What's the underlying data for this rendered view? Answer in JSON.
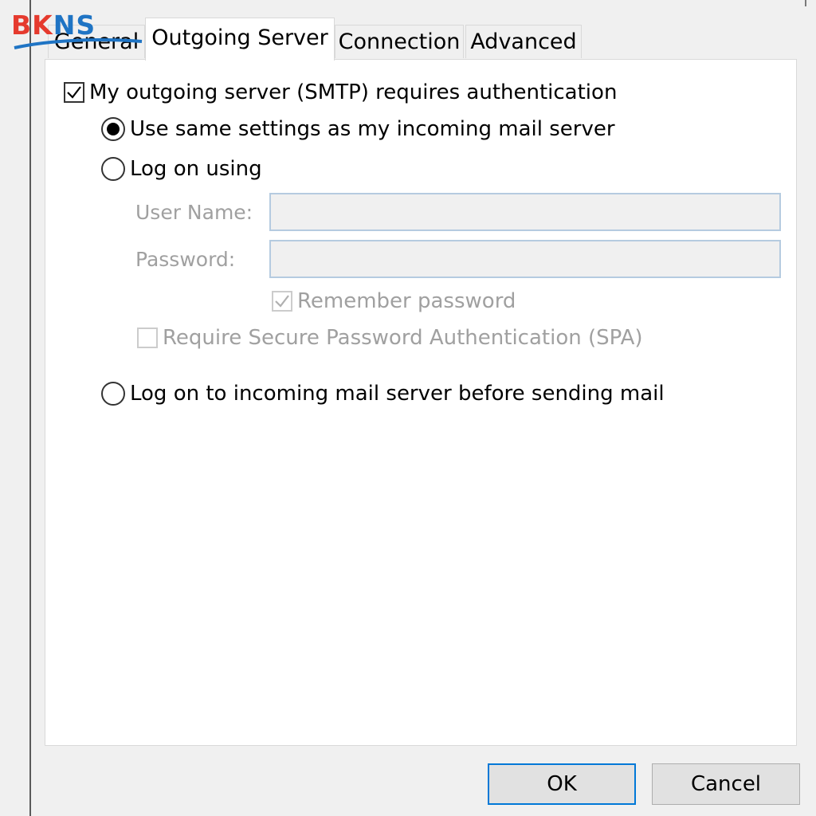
{
  "logo": {
    "b": "B",
    "k": "K",
    "n": "N",
    "s": "S"
  },
  "tabs": {
    "general": "General",
    "outgoing": "Outgoing Server",
    "connection": "Connection",
    "advanced": "Advanced"
  },
  "auth": {
    "requires_label": "My outgoing server (SMTP) requires authentication",
    "requires_checked": true,
    "same_settings_label": "Use same settings as my incoming mail server",
    "log_on_using_label": "Log on using",
    "user_name_label": "User Name:",
    "user_name_value": "",
    "password_label": "Password:",
    "password_value": "",
    "remember_label": "Remember password",
    "remember_checked": true,
    "spa_label": "Require Secure Password Authentication (SPA)",
    "spa_checked": false,
    "log_on_incoming_label": "Log on to incoming mail server before sending mail",
    "selected_option": "same_settings"
  },
  "buttons": {
    "ok": "OK",
    "cancel": "Cancel"
  },
  "colors": {
    "accent": "#0078d7",
    "logo_red": "#e53a2e",
    "logo_blue": "#1f74c4"
  }
}
